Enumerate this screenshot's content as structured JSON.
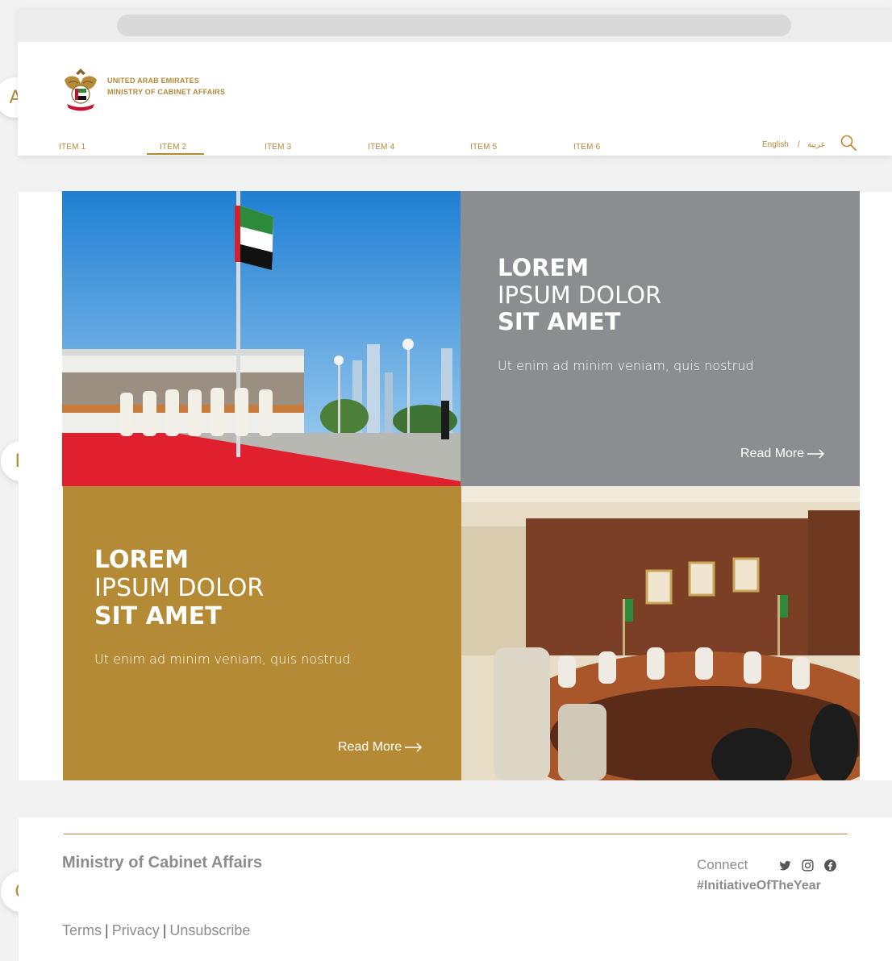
{
  "markers": {
    "a": "A",
    "b": "B",
    "c": "C"
  },
  "header": {
    "brand_line1": "UNITED ARAB EMIRATES",
    "brand_line2": "MINISTRY OF CABINET AFFAIRS",
    "nav": [
      "ITEM 1",
      "ITEM 2",
      "ITEM 3",
      "ITEM 4",
      "ITEM 5",
      "ITEM 6"
    ],
    "active_nav": "ITEM 2",
    "lang_english": "English",
    "lang_separator": "/",
    "lang_arabic": "عربية",
    "search_icon": "search-icon"
  },
  "tiles": {
    "grey": {
      "line1": "LOREM",
      "line2": "IPSUM DOLOR",
      "line3": "SIT AMET",
      "subtitle": "Ut enim ad minim veniam, quis nostrud",
      "read_more": "Read More"
    },
    "gold": {
      "line1": "LOREM",
      "line2": "IPSUM DOLOR",
      "line3": "SIT AMET",
      "subtitle": "Ut enim ad minim veniam, quis nostrud",
      "read_more": "Read More"
    }
  },
  "footer": {
    "title": "Ministry of Cabinet Affairs",
    "connect": "Connect",
    "social_icons": [
      "twitter-icon",
      "instagram-icon",
      "facebook-icon"
    ],
    "hashtag": "#InitiativeOfTheYear",
    "links": [
      "Terms",
      "Privacy",
      "Unsubscribe"
    ],
    "link_separator": "|"
  },
  "colors": {
    "gold": "#b58a37",
    "grey_tile": "#8b8e90",
    "gold_tile": "#b48b34",
    "footer_text": "#8c8c8c"
  }
}
